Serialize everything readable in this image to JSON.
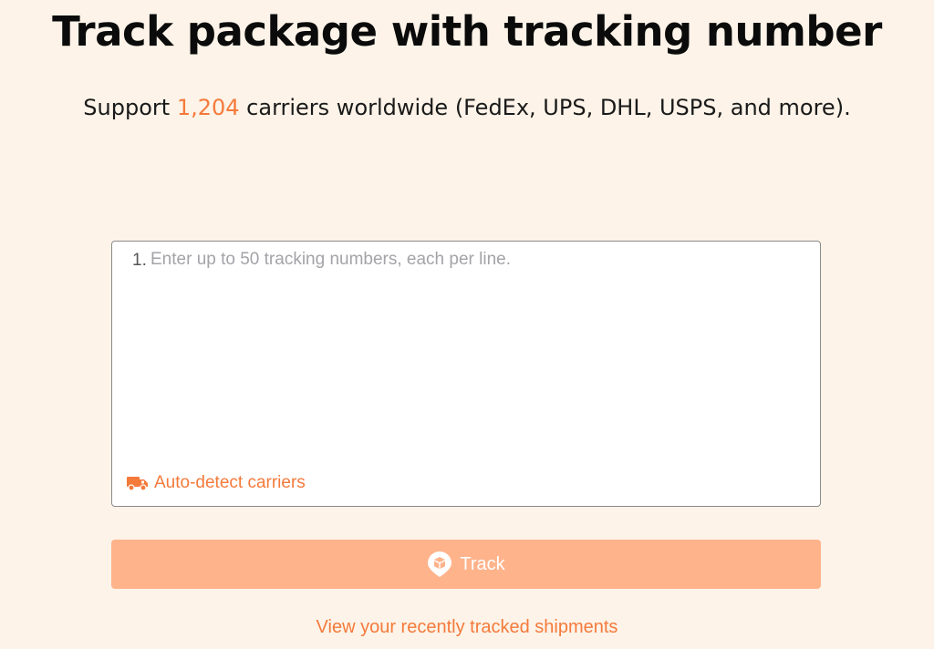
{
  "header": {
    "title": "Track package with tracking number",
    "subtitle_prefix": "Support ",
    "carrier_count": "1,204",
    "subtitle_suffix": " carriers worldwide (FedEx, UPS, DHL, USPS, and more)."
  },
  "tracking_input": {
    "line_number": "1.",
    "placeholder": "Enter up to 50 tracking numbers, each per line.",
    "value": ""
  },
  "auto_detect": {
    "icon": "truck-icon",
    "label": "Auto-detect carriers"
  },
  "track_button": {
    "icon": "package-location-icon",
    "label": "Track"
  },
  "recent_link": {
    "label": "View your recently tracked shipments"
  },
  "colors": {
    "background": "#fdf3e8",
    "accent": "#f47a3b",
    "button_disabled": "#ffb38b"
  }
}
